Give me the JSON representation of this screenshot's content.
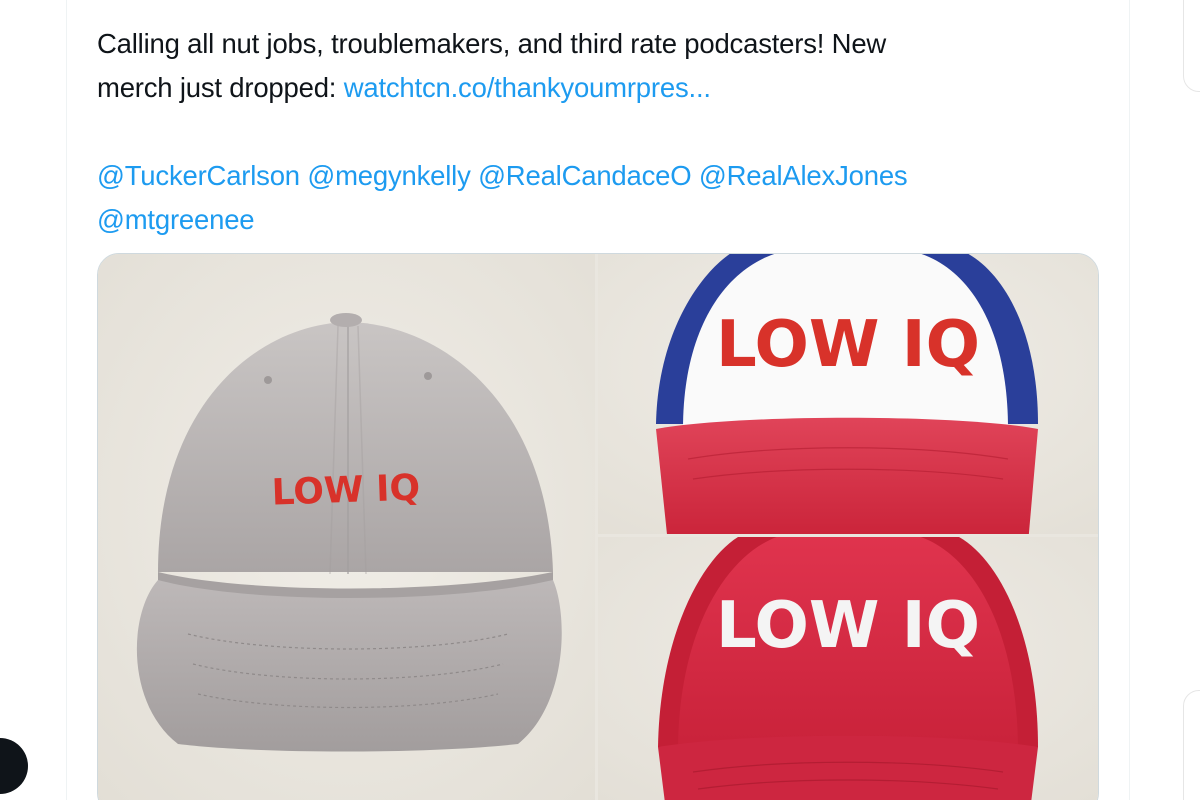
{
  "tweet": {
    "text_line1_plain": "Calling all nut jobs, troublemakers, and third rate podcasters! New",
    "text_line2_plain": "merch just dropped: ",
    "link": "watchtcn.co/thankyoumrpres...",
    "mentions": [
      "@TuckerCarlson",
      "@megynkelly",
      "@RealCandaceO",
      "@RealAlexJones",
      "@mtgreenee"
    ]
  },
  "media": {
    "images": [
      {
        "name": "grey-dad-hat",
        "embroidery": "LOW IQ",
        "hat_color": "#b9b4b4",
        "text_color": "#d8322a"
      },
      {
        "name": "white-front-trucker-hat",
        "embroidery": "LOW IQ",
        "front_color": "#ffffff",
        "mesh_color": "#2a3f9a",
        "brim_color": "#d9344a",
        "text_color": "#d8322a"
      },
      {
        "name": "red-trucker-hat",
        "embroidery": "LOW IQ",
        "hat_color": "#d62a43",
        "text_color": "#f4f4f4"
      }
    ]
  },
  "colors": {
    "link": "#1d9bf0",
    "text": "#0f1419",
    "border": "#cfd9de"
  }
}
